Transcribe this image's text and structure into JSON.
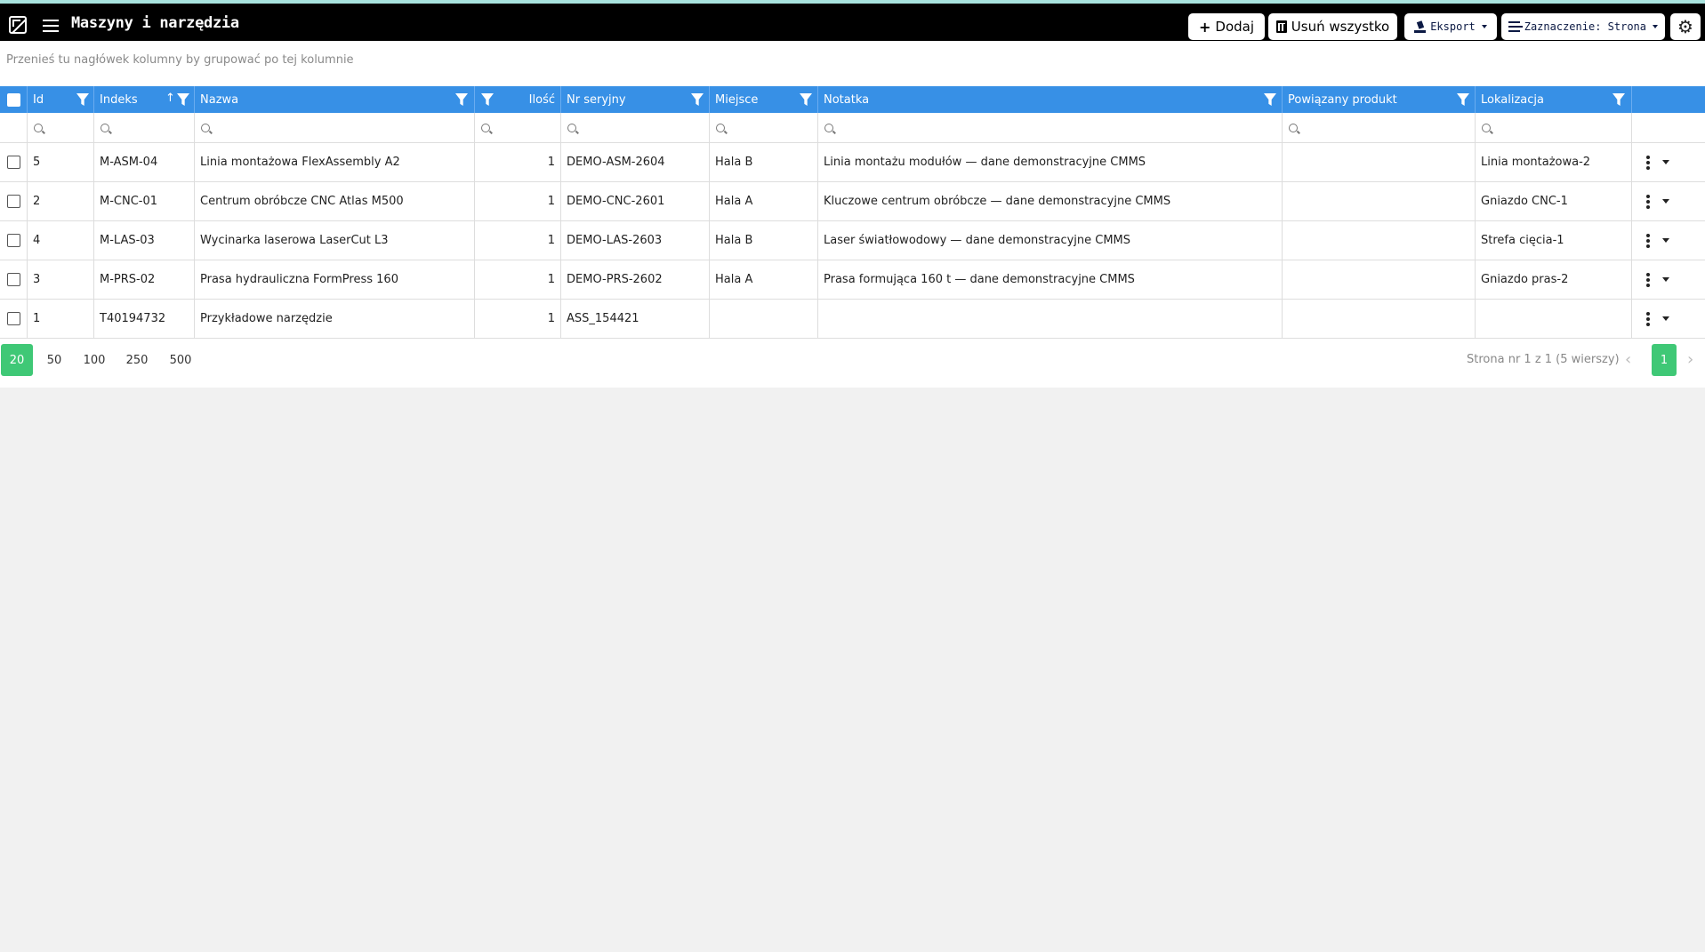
{
  "app": {
    "title": "Maszyny i narzędzia",
    "accent_color": "#3790e6",
    "pager_color": "#3fc876",
    "icons": [
      "app-logo-icon",
      "hamburger-menu-icon",
      "plus-icon",
      "trash-icon",
      "export-icon",
      "sliders-icon",
      "gear-icon",
      "filter-icon",
      "search-icon",
      "kebab-icon"
    ]
  },
  "toolbar": {
    "add_label": "Dodaj",
    "delete_all_label": "Usuń wszystko",
    "export_label": "Eksport",
    "selection_label": "Zaznaczenie: Strona"
  },
  "group_hint": "Przenieś tu nagłówek kolumny by grupować po tej kolumnie",
  "columns": {
    "id": "Id",
    "index": "Indeks",
    "name": "Nazwa",
    "qty": "Ilość",
    "serial": "Nr seryjny",
    "place": "Miejsce",
    "note": "Notatka",
    "related": "Powiązany produkt",
    "location": "Lokalizacja"
  },
  "rows": [
    {
      "id": "5",
      "index": "M-ASM-04",
      "name": "Linia montażowa FlexAssembly A2",
      "qty": "1",
      "serial": "DEMO-ASM-2604",
      "place": "Hala B",
      "note": "Linia montażu modułów — dane demonstracyjne CMMS",
      "related": "",
      "location": "Linia montażowa-2"
    },
    {
      "id": "2",
      "index": "M-CNC-01",
      "name": "Centrum obróbcze CNC Atlas M500",
      "qty": "1",
      "serial": "DEMO-CNC-2601",
      "place": "Hala A",
      "note": "Kluczowe centrum obróbcze — dane demonstracyjne CMMS",
      "related": "",
      "location": "Gniazdo CNC-1"
    },
    {
      "id": "4",
      "index": "M-LAS-03",
      "name": "Wycinarka laserowa LaserCut L3",
      "qty": "1",
      "serial": "DEMO-LAS-2603",
      "place": "Hala B",
      "note": "Laser światłowodowy — dane demonstracyjne CMMS",
      "related": "",
      "location": "Strefa cięcia-1"
    },
    {
      "id": "3",
      "index": "M-PRS-02",
      "name": "Prasa hydrauliczna FormPress 160",
      "qty": "1",
      "serial": "DEMO-PRS-2602",
      "place": "Hala A",
      "note": "Prasa formująca 160 t — dane demonstracyjne CMMS",
      "related": "",
      "location": "Gniazdo pras-2"
    },
    {
      "id": "1",
      "index": "T40194732",
      "name": "Przykładowe narzędzie",
      "qty": "1",
      "serial": "ASS_154421",
      "place": "",
      "note": "",
      "related": "",
      "location": ""
    }
  ],
  "pager": {
    "sizes": [
      "20",
      "50",
      "100",
      "250",
      "500"
    ],
    "active_size": "20",
    "info": "Strona nr 1 z 1 (5 wierszy)",
    "current_page": "1"
  }
}
